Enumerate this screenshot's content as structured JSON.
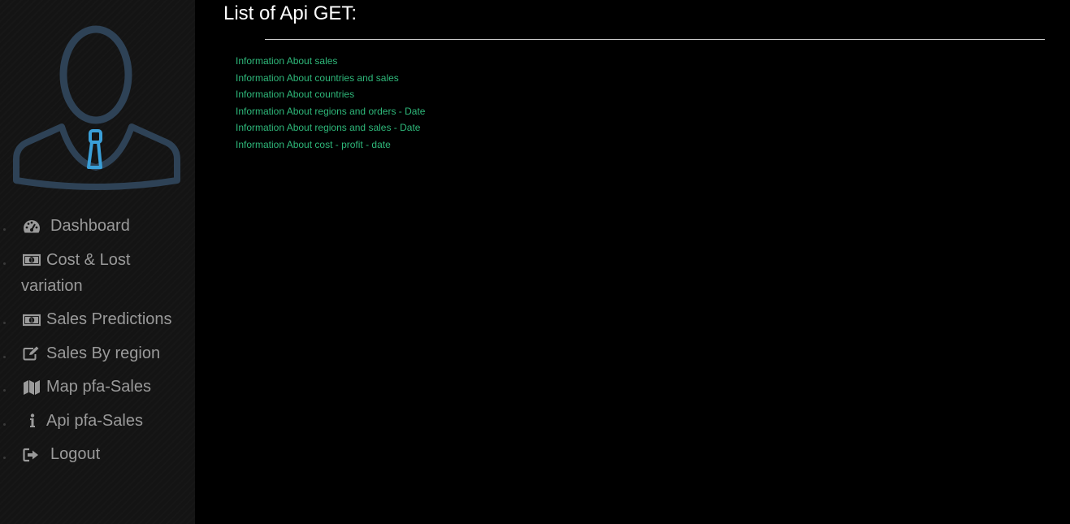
{
  "sidebar": {
    "avatar_icon": "user-silhouette-with-tie",
    "items": [
      {
        "label": "Dashboard",
        "icon": "dashboard-icon"
      },
      {
        "label": "Cost & Lost variation",
        "icon": "money-icon"
      },
      {
        "label": "Sales Predictions",
        "icon": "money-icon"
      },
      {
        "label": "Sales By region",
        "icon": "edit-icon"
      },
      {
        "label": "Map pfa-Sales",
        "icon": "map-icon"
      },
      {
        "label": "Api pfa-Sales",
        "icon": "info-icon"
      },
      {
        "label": "Logout",
        "icon": "sign-out-icon"
      }
    ]
  },
  "main": {
    "title": "List of Api GET:",
    "links": [
      "Information About sales",
      "Information About countries and sales",
      "Information About countries",
      "Information About regions and orders - Date",
      "Information About regions and sales - Date",
      "Information About cost - profit - date"
    ]
  },
  "colors": {
    "sidebar_bg": "#141414",
    "main_bg": "#000000",
    "nav_text": "#9a9a9a",
    "link": "#2eb87a",
    "avatar_outline": "#2e4256",
    "tie": "#3a9fd8"
  }
}
